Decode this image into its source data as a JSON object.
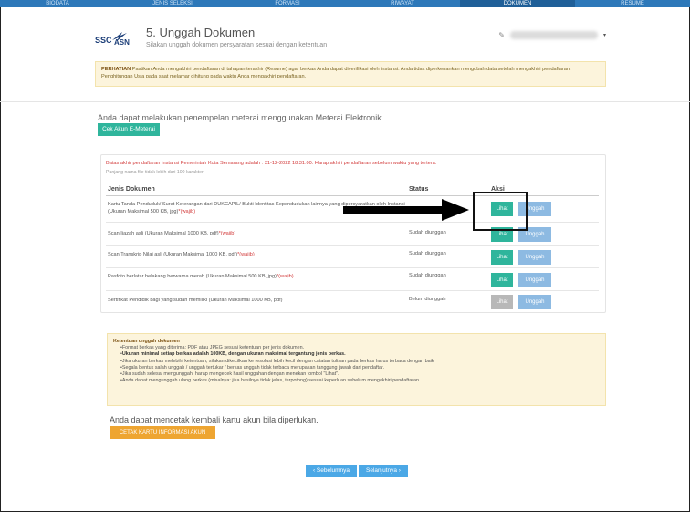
{
  "nav": {
    "tabs": [
      {
        "label": "BIODATA"
      },
      {
        "label": "JENIS SELEKSI"
      },
      {
        "label": "FORMASI"
      },
      {
        "label": "RIWAYAT"
      },
      {
        "label": "DOKUMEN"
      },
      {
        "label": "RESUME"
      }
    ],
    "active": "DOKUMEN"
  },
  "header": {
    "logo_text": "SSC ASN",
    "title": "5. Unggah Dokumen",
    "subtitle": "Silakan unggah dokumen persyaratan sesuai dengan ketentuan",
    "user_menu_caret": "▾",
    "user_icon": "user-icon"
  },
  "alert": {
    "label": "PERHATIAN",
    "text": " Pastikan Anda mengakhiri pendaftaran di tahapan terakhir (Resume) agar berkas Anda dapat diverifikasi oleh instansi. Anda tidak diperkenankan mengubah data setelah mengakhiri pendaftaran. Penghitungan Usia pada saat melamar dihitung pada waktu Anda mengakhiri pendaftaran."
  },
  "emeterai": {
    "text": "Anda dapat melakukan penempelan meterai menggunakan Meterai Elektronik.",
    "button": "Cek Akun E-Meterai"
  },
  "documents": {
    "deadline": "Batas akhir pendaftaran Instansi Pemerintah Kota Semarang adalah : 31-12-2022 18:31:00. Harap akhiri pendaftaran sebelum waktu yang tertera.",
    "char_limit": "Panjang nama file tidak lebih dari 100 karakter",
    "headers": {
      "doc": "Jenis Dokumen",
      "status": "Status",
      "action": "Aksi"
    },
    "rows": [
      {
        "doc": "Kartu Tanda Penduduk/ Surat Keterangan dari DUKCAPIL/ Bukti Identitas Kependudukan lainnya yang dipersyaratkan oleh Instansi (Ukuran Maksimal 500 KB, jpg)",
        "req": "*(wajib)",
        "status": "",
        "view": "Lihat",
        "upload": "Unggah"
      },
      {
        "doc": "Scan Ijazah asli (Ukuran Maksimal 1000 KB, pdf)",
        "req": "*(wajib)",
        "status": "Sudah diunggah",
        "view": "Lihat",
        "upload": "Unggah"
      },
      {
        "doc": "Scan Transkrip Nilai asli (Ukuran Maksimal 1000 KB, pdf)",
        "req": "*(wajib)",
        "status": "Sudah diunggah",
        "view": "Lihat",
        "upload": "Unggah"
      },
      {
        "doc": "Pasfoto berlatar belakang berwarna merah (Ukuran Maksimal 500 KB, jpg)",
        "req": "*(wajib)",
        "status": "Sudah diunggah",
        "view": "Lihat",
        "upload": "Unggah"
      },
      {
        "doc": "Sertifikat Pendidik bagi yang sudah memiliki (Ukuran Maksimal 1000 KB, pdf)",
        "req": "",
        "status": "Belum diunggah",
        "view": "Lihat",
        "upload": "Unggah"
      }
    ]
  },
  "rules": {
    "title": "Ketentuan unggah dokumen",
    "items": [
      "Format berkas yang diterima: PDF atau JPEG sesuai ketentuan per jenis dokumen.",
      "Ukuran minimal setiap berkas adalah 100KB, dengan ukuran maksimal tergantung jenis berkas.",
      "Jika ukuran berkas melebihi ketentuan, silakan dikecilkan ke resolusi lebih kecil dengan catatan tulisan pada berkas harus terbaca dengan baik",
      "Segala bentuk salah unggah / unggah tertukar / berkas unggah tidak terbaca merupakan tanggung jawab dari pendaftar.",
      "Jika sudah selesai mengunggah, harap mengecek hasil unggahan dengan menekan tombol \"Lihat\".",
      "Anda dapat mengunggah ulang berkas (misalnya: jika hasilnya tidak jelas, terpotong) sesuai keperluan sebelum mengakhiri pendaftaran."
    ]
  },
  "print": {
    "text": "Anda dapat mencetak kembali kartu akun bila diperlukan.",
    "button": "CETAK KARTU INFORMASI AKUN"
  },
  "pager": {
    "prev": "‹ Sebelumnya",
    "next": "Selanjutnya ›"
  },
  "colors": {
    "nav": "#2d78b9",
    "green": "#2fb59c",
    "blue_light": "#8dbae2",
    "orange": "#eea531",
    "warning_bg": "#fcf4dc",
    "required": "#d23a3a"
  }
}
